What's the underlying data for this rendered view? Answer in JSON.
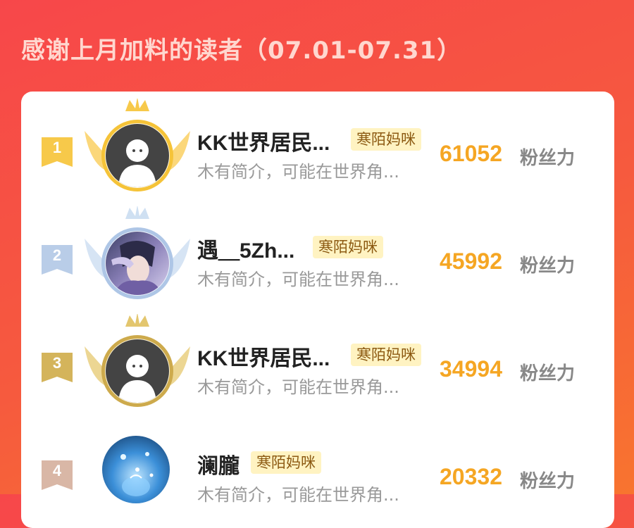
{
  "header": {
    "title": "感谢上月加料的读者（07.01-07.31）"
  },
  "colors": {
    "gold": "#f5c338",
    "silver": "#b9cde8",
    "bronze": "#d4b45b",
    "fourth": "#d9b7a6",
    "score": "#f5a623"
  },
  "readers": [
    {
      "rank": "1",
      "name": "KK世界居民...",
      "tag": "寒陌妈咪",
      "bio": "木有简介，可能在世界角...",
      "score": "61052",
      "unit": "粉丝力",
      "avatar_icon": "default-person-icon"
    },
    {
      "rank": "2",
      "name": "遇＿5Zh...",
      "tag": "寒陌妈咪",
      "bio": "木有简介，可能在世界角...",
      "score": "45992",
      "unit": "粉丝力",
      "avatar_icon": "anime-character-avatar"
    },
    {
      "rank": "3",
      "name": "KK世界居民...",
      "tag": "寒陌妈咪",
      "bio": "木有简介，可能在世界角...",
      "score": "34994",
      "unit": "粉丝力",
      "avatar_icon": "default-person-icon"
    },
    {
      "rank": "4",
      "name": "澜朧",
      "tag": "寒陌妈咪",
      "bio": "木有简介，可能在世界角...",
      "score": "20332",
      "unit": "粉丝力",
      "avatar_icon": "blue-bottle-avatar"
    }
  ]
}
